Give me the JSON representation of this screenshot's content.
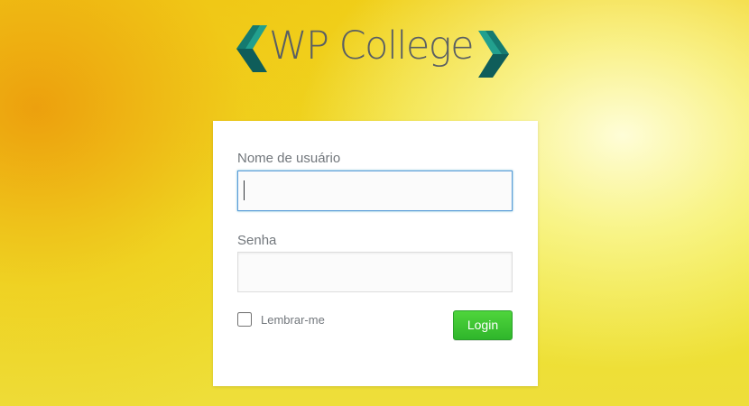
{
  "logo": {
    "text": "WP College",
    "icon_left": "chevron-left-icon",
    "icon_right": "chevron-right-icon",
    "colors": {
      "chevron_dark": "#0f5d5a",
      "chevron_mid": "#157a70",
      "chevron_light": "#22a08e",
      "text": "#5a5f63"
    }
  },
  "login_form": {
    "username_label": "Nome de usuário",
    "username_value": "",
    "password_label": "Senha",
    "password_value": "",
    "remember_label": "Lembrar-me",
    "remember_checked": false,
    "submit_label": "Login"
  },
  "colors": {
    "background_warm": "#f0c518",
    "background_highlight": "#fbf8b8",
    "card": "#ffffff",
    "focus_border": "#5b9dd9",
    "button": "#33bb2f"
  }
}
